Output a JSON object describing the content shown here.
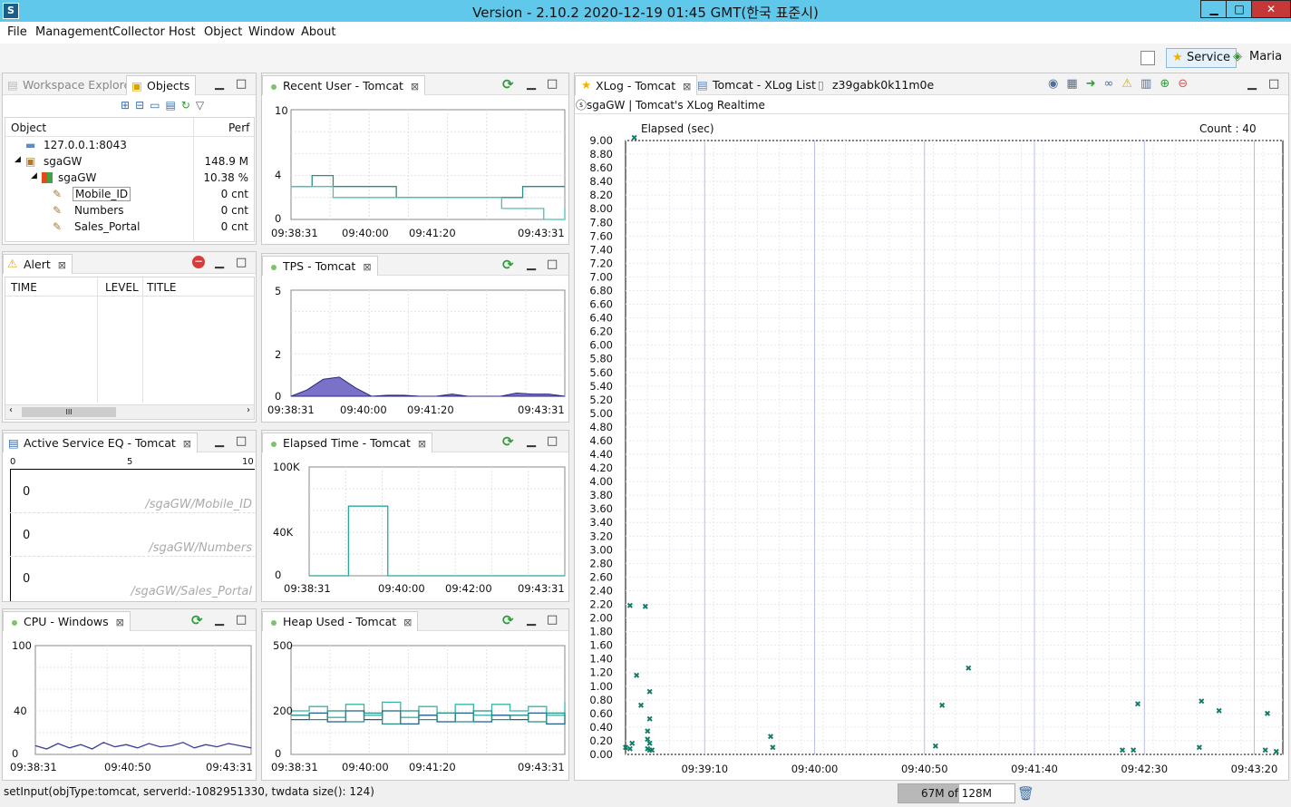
{
  "window": {
    "title": "Version - 2.10.2 2020-12-19 01:45 GMT(한국 표준시)",
    "min": "▁",
    "max": "□",
    "close": "✕"
  },
  "menu": [
    "File",
    "Management",
    "Collector",
    "Host",
    "Object",
    "Window",
    "About"
  ],
  "perspectives": {
    "service": "Service",
    "maria": "Maria"
  },
  "objects_panel": {
    "tabs": [
      "Workspace Explorer",
      "Objects"
    ],
    "headers": [
      "Object",
      "Perf"
    ],
    "rows": [
      {
        "name": "127.0.0.1:8043",
        "perf": ""
      },
      {
        "name": "sgaGW",
        "perf": "148.9 M"
      },
      {
        "name": "sgaGW",
        "perf": "10.38 %"
      },
      {
        "name": "Mobile_ID",
        "perf": "0 cnt"
      },
      {
        "name": "Numbers",
        "perf": "0 cnt"
      },
      {
        "name": "Sales_Portal",
        "perf": "0 cnt"
      }
    ]
  },
  "alert_panel": {
    "tab": "Alert",
    "headers": [
      "TIME",
      "LEVEL",
      "TITLE"
    ],
    "scroll_thumb": "III"
  },
  "active_service_panel": {
    "tab": "Active Service EQ - Tomcat",
    "scale": [
      "0",
      "5",
      "10"
    ],
    "rows": [
      {
        "count": "0",
        "label": "/sgaGW/Mobile_ID"
      },
      {
        "count": "0",
        "label": "/sgaGW/Numbers"
      },
      {
        "count": "0",
        "label": "/sgaGW/Sales_Portal"
      }
    ]
  },
  "recent_user": {
    "tab": "Recent User - Tomcat",
    "y_ticks": [
      "10",
      "4",
      "0"
    ],
    "x_ticks": [
      "09:38:31",
      "09:40:00",
      "09:41:20",
      "09:43:31"
    ]
  },
  "tps": {
    "tab": "TPS - Tomcat",
    "y_ticks": [
      "5",
      "2",
      "0"
    ],
    "x_ticks": [
      "09:38:31",
      "09:40:00",
      "09:41:20",
      "09:43:31"
    ]
  },
  "elapsed_time": {
    "tab": "Elapsed Time - Tomcat",
    "y_ticks": [
      "100K",
      "40K",
      "0"
    ],
    "x_ticks": [
      "09:38:31",
      "09:40:00",
      "09:42:00",
      "09:43:31"
    ]
  },
  "heap_used": {
    "tab": "Heap Used - Tomcat",
    "y_ticks": [
      "500",
      "200",
      "0"
    ],
    "x_ticks": [
      "09:38:31",
      "09:40:00",
      "09:41:20",
      "09:43:31"
    ]
  },
  "cpu": {
    "tab": "CPU - Windows",
    "y_ticks": [
      "100",
      "40",
      "0"
    ],
    "x_ticks": [
      "09:38:31",
      "09:40:50",
      "09:43:31"
    ]
  },
  "xlog": {
    "tabs": [
      "XLog - Tomcat",
      "Tomcat - XLog List",
      "z39gabk0k11m0e"
    ],
    "subtitle": "ⓢsgaGW | Tomcat's XLog Realtime",
    "ylabel": "Elapsed (sec)",
    "count": "Count : 40",
    "x_ticks": [
      "09:39:10",
      "09:40:00",
      "09:40:50",
      "09:41:40",
      "09:42:30",
      "09:43:20"
    ]
  },
  "status": {
    "text": "setInput(objType:tomcat, serverId:-1082951330, twdata size(): 124)",
    "heap": "67M of 128M"
  },
  "colors": {
    "titlebar": "#60c8ea",
    "xlog_point": "#137a66",
    "tps_fill": "#7a72c8",
    "series_teal": "#2a9d8f"
  },
  "chart_data": [
    {
      "type": "scatter",
      "title": "Tomcat's XLog Realtime",
      "ylabel": "Elapsed (sec)",
      "ylim": [
        0,
        9.0
      ],
      "x_unit": "time",
      "points": [
        {
          "x": "09:38:34",
          "y": 0.06
        },
        {
          "x": "09:38:38",
          "y": 9.0
        },
        {
          "x": "09:38:36",
          "y": 2.14
        },
        {
          "x": "09:38:43",
          "y": 2.13
        },
        {
          "x": "09:38:39",
          "y": 1.12
        },
        {
          "x": "09:38:41",
          "y": 0.68
        },
        {
          "x": "09:38:45",
          "y": 0.88
        },
        {
          "x": "09:38:45",
          "y": 0.48
        },
        {
          "x": "09:38:44",
          "y": 0.3
        },
        {
          "x": "09:38:44",
          "y": 0.18
        },
        {
          "x": "09:38:45",
          "y": 0.12
        },
        {
          "x": "09:38:36",
          "y": 0.04
        },
        {
          "x": "09:38:37",
          "y": 0.12
        },
        {
          "x": "09:38:44",
          "y": 0.04
        },
        {
          "x": "09:38:45",
          "y": 0.02
        },
        {
          "x": "09:38:46",
          "y": 0.02
        },
        {
          "x": "09:39:40",
          "y": 0.22
        },
        {
          "x": "09:39:41",
          "y": 0.06
        },
        {
          "x": "09:40:55",
          "y": 0.08
        },
        {
          "x": "09:40:58",
          "y": 0.68
        },
        {
          "x": "09:41:10",
          "y": 1.22
        },
        {
          "x": "09:42:20",
          "y": 0.02
        },
        {
          "x": "09:42:25",
          "y": 0.02
        },
        {
          "x": "09:42:27",
          "y": 0.7
        },
        {
          "x": "09:42:55",
          "y": 0.06
        },
        {
          "x": "09:42:56",
          "y": 0.74
        },
        {
          "x": "09:43:04",
          "y": 0.6
        },
        {
          "x": "09:43:26",
          "y": 0.56
        },
        {
          "x": "09:43:25",
          "y": 0.02
        },
        {
          "x": "09:43:30",
          "y": 0.0
        }
      ]
    },
    {
      "type": "line",
      "title": "Recent User - Tomcat",
      "ylim": [
        0,
        10
      ],
      "series": [
        {
          "values": [
            3,
            4,
            3,
            3,
            3,
            2,
            2,
            2,
            2,
            2,
            2,
            3,
            3,
            3
          ]
        },
        {
          "values": [
            3,
            3,
            2,
            2,
            2,
            2,
            2,
            2,
            2,
            2,
            1,
            1,
            0,
            1
          ]
        }
      ]
    },
    {
      "type": "area",
      "title": "TPS - Tomcat",
      "ylim": [
        0,
        5
      ],
      "values": [
        0,
        0.3,
        0.8,
        0.9,
        0.4,
        0,
        0.05,
        0.05,
        0,
        0,
        0.1,
        0,
        0,
        0,
        0.15,
        0.1,
        0.1,
        0
      ]
    },
    {
      "type": "line",
      "title": "Elapsed Time - Tomcat",
      "ylim": [
        0,
        100000
      ],
      "values": [
        0,
        0,
        64000,
        64000,
        0,
        0,
        0,
        0,
        0,
        0,
        0,
        0,
        0,
        0
      ]
    },
    {
      "type": "line",
      "title": "Heap Used - Tomcat",
      "ylim": [
        0,
        500
      ],
      "series": [
        {
          "values": [
            200,
            220,
            170,
            230,
            180,
            240,
            170,
            220,
            190,
            230,
            180,
            230,
            200,
            220,
            180,
            240
          ]
        },
        {
          "values": [
            160,
            190,
            150,
            200,
            160,
            200,
            140,
            180,
            150,
            190,
            150,
            180,
            160,
            190,
            140,
            180
          ]
        },
        {
          "values": [
            180,
            160,
            200,
            150,
            190,
            140,
            200,
            160,
            190,
            150,
            200,
            160,
            180,
            150,
            190,
            160
          ]
        }
      ]
    },
    {
      "type": "line",
      "title": "CPU - Windows",
      "ylim": [
        0,
        100
      ],
      "values": [
        8,
        5,
        10,
        6,
        9,
        5,
        11,
        7,
        9,
        6,
        10,
        7,
        8,
        11,
        6,
        9,
        7,
        10,
        8,
        6
      ]
    }
  ]
}
